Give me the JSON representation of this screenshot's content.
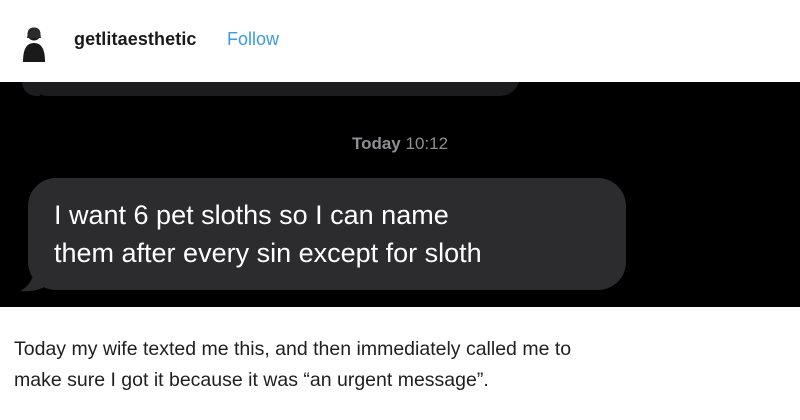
{
  "post": {
    "username": "getlitaesthetic",
    "follow_label": "Follow",
    "avatar_icon": "person-silhouette-icon"
  },
  "imessage": {
    "timestamp_day": "Today",
    "timestamp_time": "10:12",
    "message": "I want 6 pet sloths so I can name\nthem after every sin except for sloth",
    "bubble_color": "#2c2c2e",
    "background_color": "#000000"
  },
  "caption": "Today my wife texted me this, and then immediately called me to\nmake sure I got it because it was “an urgent message”.",
  "colors": {
    "follow_link": "#3a9be0",
    "text": "#1f1f1f"
  }
}
